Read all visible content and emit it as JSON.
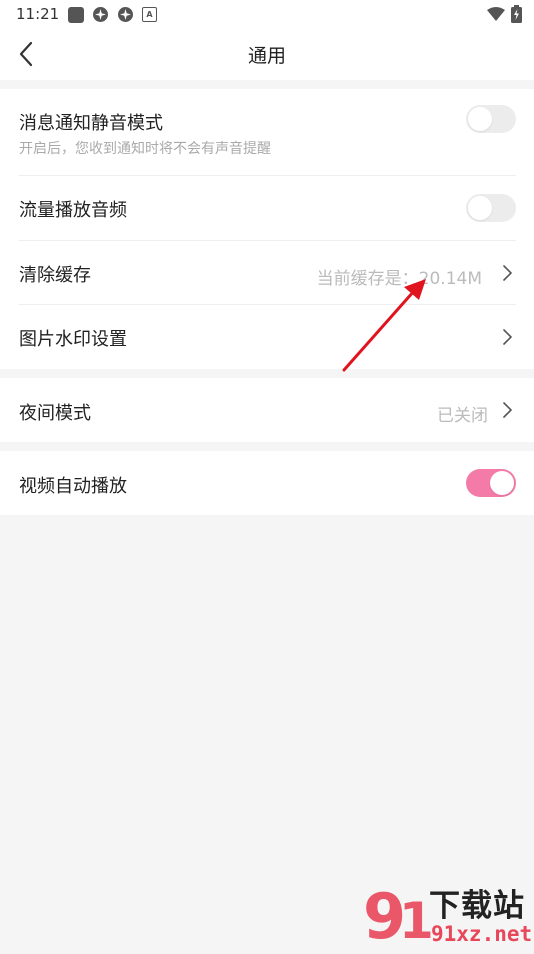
{
  "status": {
    "time": "11:21",
    "icons": [
      "app-square-icon",
      "settings-gear-icon",
      "settings-gear-icon",
      "a-badge-icon"
    ],
    "right_icons": [
      "wifi-icon",
      "battery-charging-icon"
    ]
  },
  "header": {
    "title": "通用",
    "back_icon": "back-arrow-icon"
  },
  "settings": {
    "mute_notification": {
      "label": "消息通知静音模式",
      "description": "开启后，您收到通知时将不会有声音提醒",
      "enabled": false
    },
    "data_audio": {
      "label": "流量播放音频",
      "enabled": false
    },
    "clear_cache": {
      "label": "清除缓存",
      "value": "当前缓存是：20.14M"
    },
    "watermark": {
      "label": "图片水印设置"
    },
    "night_mode": {
      "label": "夜间模式",
      "value": "已关闭"
    },
    "autoplay": {
      "label": "视频自动播放",
      "enabled": true
    }
  },
  "branding": {
    "watermark_text": "下载站",
    "watermark_domain": "91xz.net"
  },
  "colors": {
    "accent": "#f47aa8",
    "annotation_arrow": "#e0141e"
  }
}
